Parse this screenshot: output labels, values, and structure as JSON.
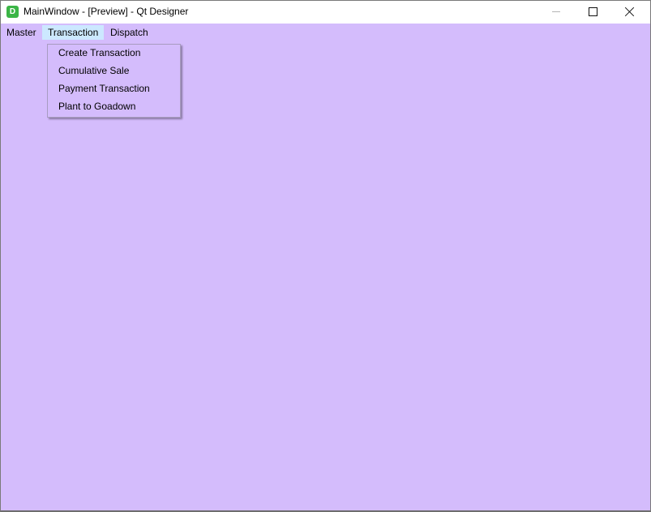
{
  "window": {
    "title": "MainWindow - [Preview] - Qt Designer",
    "app_icon_letter": "D",
    "icons": {
      "app": "designer-app-icon",
      "minimize": "minimize-icon",
      "maximize": "maximize-icon",
      "close": "close-icon"
    }
  },
  "menubar": {
    "items": [
      {
        "label": "Master"
      },
      {
        "label": "Transaction",
        "active": true
      },
      {
        "label": "Dispatch"
      }
    ]
  },
  "dropdown": {
    "items": [
      {
        "label": "Create Transaction"
      },
      {
        "label": "Cumulative Sale"
      },
      {
        "label": "Payment Transaction"
      },
      {
        "label": "Plant to Goadown"
      }
    ]
  },
  "colors": {
    "client_background": "#d4bcfc",
    "menu_highlight": "#cce8ff",
    "titlebar": "#ffffff",
    "app_icon": "#3bb546"
  }
}
